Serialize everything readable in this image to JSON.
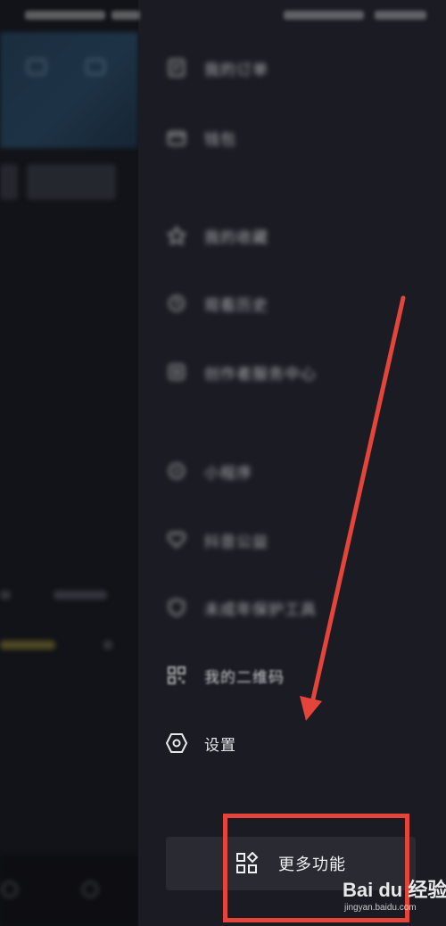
{
  "drawer": {
    "items": [
      {
        "label": "我的订单",
        "icon": "receipt-icon"
      },
      {
        "label": "钱包",
        "icon": "wallet-icon"
      },
      {
        "label": "我的收藏",
        "icon": "star-icon"
      },
      {
        "label": "观看历史",
        "icon": "clock-icon"
      },
      {
        "label": "创作者服务中心",
        "icon": "creator-icon"
      },
      {
        "label": "小程序",
        "icon": "mini-program-icon"
      },
      {
        "label": "抖音公益",
        "icon": "heart-icon"
      },
      {
        "label": "未成年保护工具",
        "icon": "shield-icon"
      },
      {
        "label": "我的二维码",
        "icon": "qr-code-icon"
      },
      {
        "label": "设置",
        "icon": "hexagon-settings-icon"
      }
    ],
    "more_button": {
      "label": "更多功能",
      "icon": "grid-apps-icon"
    }
  },
  "watermark": {
    "logo": "Bai du 经验",
    "sub": "jingyan.baidu.com"
  },
  "annotation_color": "#e5443a"
}
